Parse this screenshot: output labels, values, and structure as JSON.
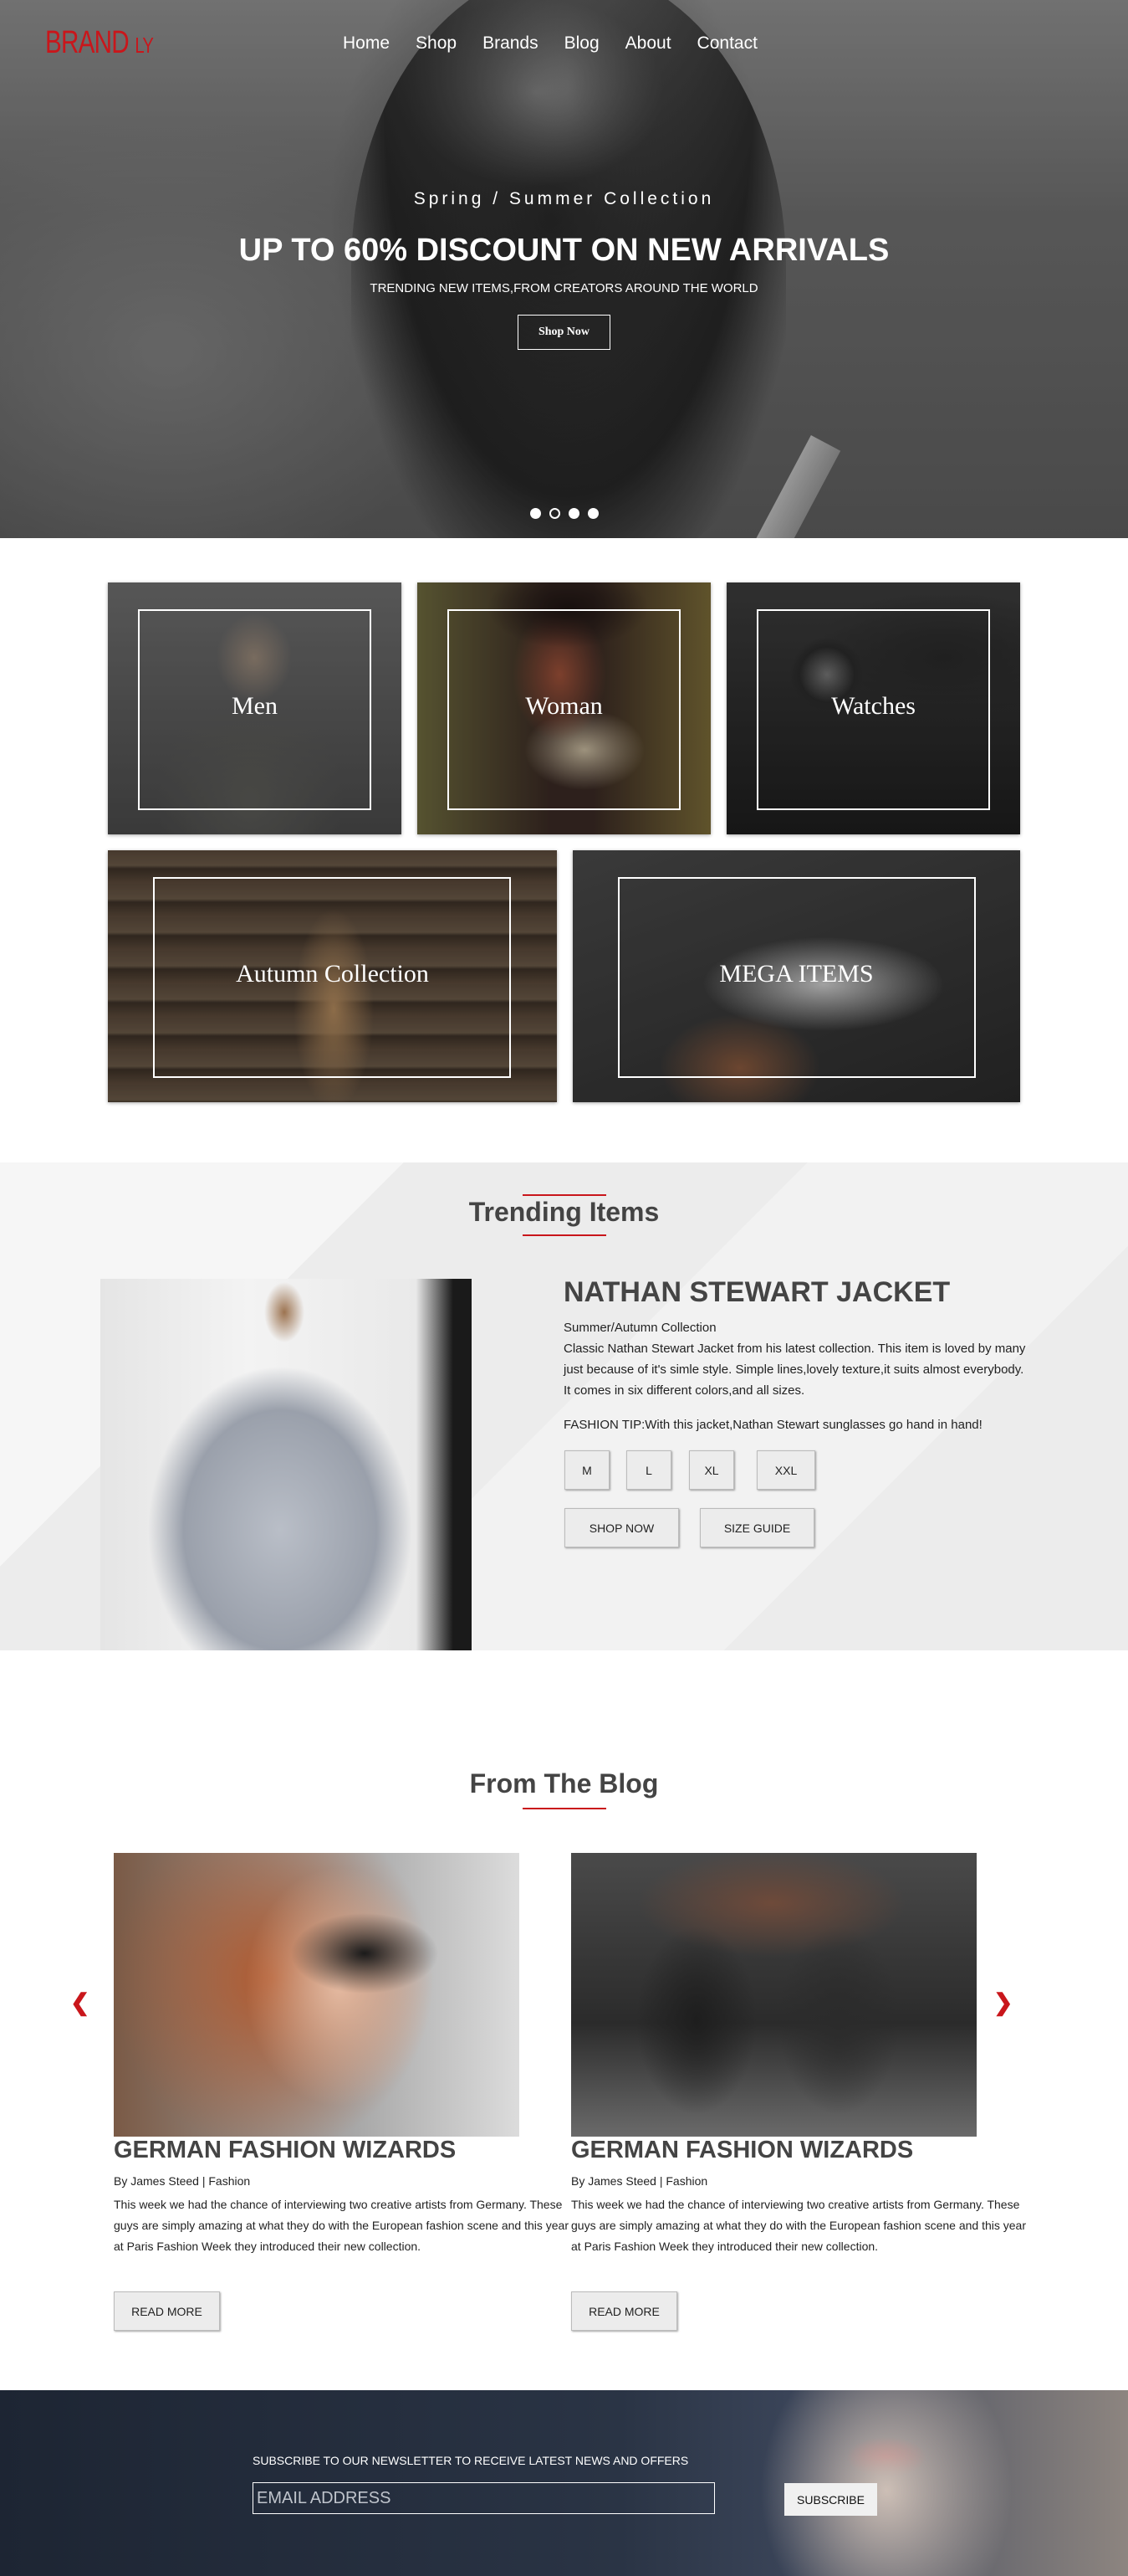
{
  "brand": {
    "name": "BRAND",
    "suffix": "LY",
    "color": "#c9161b"
  },
  "nav": [
    {
      "label": "Home"
    },
    {
      "label": "Shop"
    },
    {
      "label": "Brands"
    },
    {
      "label": "Blog"
    },
    {
      "label": "About"
    },
    {
      "label": "Contact"
    }
  ],
  "hero": {
    "kicker": "Spring / Summer Collection",
    "title": "UP TO 60% DISCOUNT ON NEW ARRIVALS",
    "subtitle": "TRENDING NEW ITEMS,FROM CREATORS AROUND THE WORLD",
    "button": "Shop Now",
    "slides": 4,
    "active_slide": 2
  },
  "categories": [
    {
      "label": "Men"
    },
    {
      "label": "Woman"
    },
    {
      "label": "Watches"
    },
    {
      "label": "Autumn Collection"
    },
    {
      "label": "MEGA ITEMS"
    }
  ],
  "trending": {
    "title": "Trending Items",
    "product_name": "NATHAN STEWART JACKET",
    "collection": "Summer/Autumn Collection",
    "description": "Classic Nathan Stewart Jacket from his latest collection. This item is loved by many just because of it's simle style. Simple lines,lovely texture,it suits almost everybody. It comes in six different colors,and all sizes.",
    "tip": "FASHION TIP:With this jacket,Nathan Stewart sunglasses go hand in hand!",
    "sizes": [
      "M",
      "L",
      "XL",
      "XXL"
    ],
    "shop_button": "SHOP NOW",
    "size_guide_button": "SIZE GUIDE"
  },
  "blog": {
    "title": "From The Blog",
    "posts": [
      {
        "title": "GERMAN FASHION WIZARDS",
        "author": "By James Steed",
        "category": "Fashion",
        "text": "This week we had the chance of interviewing two creative artists from Germany. These guys are simply amazing at what they do with the European fashion scene and this year at Paris Fashion Week they introduced their new collection.",
        "button": "READ MORE"
      },
      {
        "title": "GERMAN FASHION WIZARDS",
        "author": "By James Steed",
        "category": "Fashion",
        "text": "This week we had the chance of interviewing two creative artists from Germany. These guys are simply amazing at what they do with the European fashion scene and this year at Paris Fashion Week they introduced their new collection.",
        "button": "READ MORE"
      }
    ],
    "prev_icon": "chevron-left-icon",
    "next_icon": "chevron-right-icon"
  },
  "newsletter": {
    "label": "SUBSCRIBE TO OUR NEWSLETTER TO RECEIVE LATEST NEWS AND OFFERS",
    "placeholder": "EMAIL ADDRESS",
    "button": "SUBSCRIBE"
  }
}
